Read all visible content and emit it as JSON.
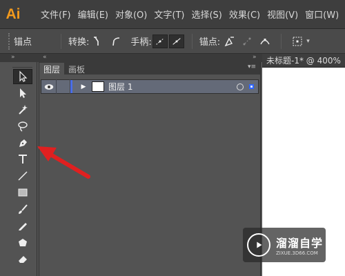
{
  "app": {
    "logo": "Ai"
  },
  "menu": [
    "文件(F)",
    "编辑(E)",
    "对象(O)",
    "文字(T)",
    "选择(S)",
    "效果(C)",
    "视图(V)",
    "窗口(W)"
  ],
  "control_bar": {
    "mode_label": "锚点",
    "convert_label": "转换:",
    "handles_label": "手柄:",
    "anchors_label": "锚点:"
  },
  "layers_panel": {
    "tabs": [
      "图层",
      "画板"
    ],
    "layer": {
      "name": "图层 1",
      "color": "#4a6ee8"
    }
  },
  "document": {
    "tab_title": "未标题-1* @ 400%"
  },
  "watermark": {
    "title": "溜溜自学",
    "subtitle": "ZIXUE.3D66.COM"
  },
  "colors": {
    "accent_logo": "#f39a1d",
    "arrow": "#e02020",
    "selected_layer_bg": "#646a78"
  }
}
